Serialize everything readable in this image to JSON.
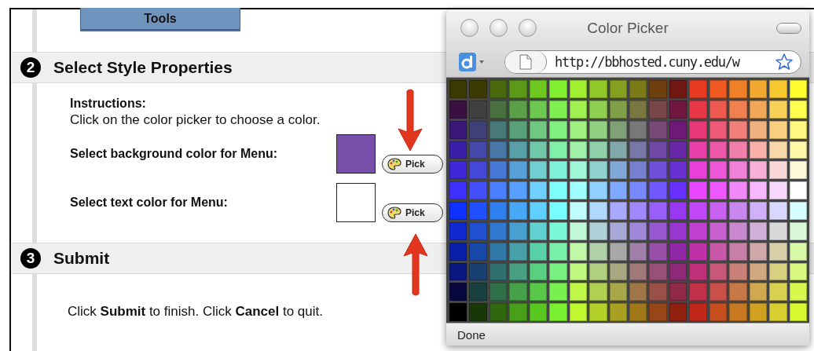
{
  "page": {
    "top_button": "Tools",
    "sections": [
      {
        "number": "2",
        "title": "Select Style Properties"
      },
      {
        "number": "3",
        "title": "Submit"
      }
    ],
    "instructions": {
      "heading": "Instructions:",
      "text": "Click on the color picker to choose a color."
    },
    "color_fields": [
      {
        "label": "Select background color for Menu:",
        "color": "#774ea8",
        "button": "Pick"
      },
      {
        "label": "Select text color for Menu:",
        "color": "#ffffff",
        "button": "Pick"
      }
    ],
    "submit_text": "Click **Submit** to finish. Click **Cancel** to quit."
  },
  "popup": {
    "window_title": "Color Picker",
    "url": "http://bbhosted.cuny.edu/w",
    "status": "Done",
    "swatch_rows": [
      {
        "swatches": [
          {
            "color": "#3a3a00"
          },
          {
            "color": "#3d3a00"
          },
          {
            "color": "#4a6a10"
          },
          {
            "color": "#5a9a18"
          },
          {
            "color": "#6ec820"
          },
          {
            "color": "#80f030"
          },
          {
            "color": "#a0f030"
          },
          {
            "color": "#90c828"
          },
          {
            "color": "#85a020"
          },
          {
            "color": "#7a7a18"
          },
          {
            "color": "#703f10"
          },
          {
            "color": "#701810"
          },
          {
            "color": "#e83a20"
          },
          {
            "color": "#f05a20"
          },
          {
            "color": "#f08028"
          },
          {
            "color": "#f0a830"
          },
          {
            "color": "#f8c830"
          },
          {
            "color": "#ffff30"
          }
        ]
      },
      {
        "swatches": [
          {
            "color": "#3a1040"
          },
          {
            "color": "#404040"
          },
          {
            "color": "#4a7040"
          },
          {
            "color": "#5aa048"
          },
          {
            "color": "#6cc850"
          },
          {
            "color": "#80f050"
          },
          {
            "color": "#a0f050"
          },
          {
            "color": "#90d050"
          },
          {
            "color": "#80a048"
          },
          {
            "color": "#787840"
          },
          {
            "color": "#784848"
          },
          {
            "color": "#701840"
          },
          {
            "color": "#e83848"
          },
          {
            "color": "#ee5a50"
          },
          {
            "color": "#f08050"
          },
          {
            "color": "#f0a858"
          },
          {
            "color": "#f8d058"
          },
          {
            "color": "#ffff50"
          }
        ]
      },
      {
        "swatches": [
          {
            "color": "#3a1878"
          },
          {
            "color": "#404078"
          },
          {
            "color": "#487878"
          },
          {
            "color": "#5aa078"
          },
          {
            "color": "#70c880"
          },
          {
            "color": "#80f080"
          },
          {
            "color": "#a0f080"
          },
          {
            "color": "#90d080"
          },
          {
            "color": "#80a078"
          },
          {
            "color": "#787878"
          },
          {
            "color": "#784878"
          },
          {
            "color": "#701878"
          },
          {
            "color": "#e83878"
          },
          {
            "color": "#ee5a78"
          },
          {
            "color": "#f08078"
          },
          {
            "color": "#f0b080"
          },
          {
            "color": "#f8d080"
          },
          {
            "color": "#fff880"
          }
        ]
      },
      {
        "swatches": [
          {
            "color": "#3a20a8"
          },
          {
            "color": "#4448a8"
          },
          {
            "color": "#4878a8"
          },
          {
            "color": "#58a0a8"
          },
          {
            "color": "#70c8a8"
          },
          {
            "color": "#80f0a8"
          },
          {
            "color": "#a0f0a8"
          },
          {
            "color": "#90d0a8"
          },
          {
            "color": "#80a8a8"
          },
          {
            "color": "#7878a8"
          },
          {
            "color": "#7048a8"
          },
          {
            "color": "#6828a8"
          },
          {
            "color": "#e840a8"
          },
          {
            "color": "#ee58a8"
          },
          {
            "color": "#f080a8"
          },
          {
            "color": "#f8b0a8"
          },
          {
            "color": "#f8d8a8"
          },
          {
            "color": "#fff8a8"
          }
        ]
      },
      {
        "swatches": [
          {
            "color": "#4028d8"
          },
          {
            "color": "#4448d8"
          },
          {
            "color": "#4878d8"
          },
          {
            "color": "#58a0d8"
          },
          {
            "color": "#70d0d0"
          },
          {
            "color": "#80f0d8"
          },
          {
            "color": "#a0f8d8"
          },
          {
            "color": "#90d0d0"
          },
          {
            "color": "#80a8d8"
          },
          {
            "color": "#7880d0"
          },
          {
            "color": "#7050d8"
          },
          {
            "color": "#6830d0"
          },
          {
            "color": "#e840d8"
          },
          {
            "color": "#ee58d8"
          },
          {
            "color": "#f080d8"
          },
          {
            "color": "#f8b0d8"
          },
          {
            "color": "#f8d8d8"
          },
          {
            "color": "#fff8d8"
          }
        ]
      },
      {
        "swatches": [
          {
            "color": "#4030ff"
          },
          {
            "color": "#4450ff"
          },
          {
            "color": "#4a80ff"
          },
          {
            "color": "#58a0ff"
          },
          {
            "color": "#70d0ff"
          },
          {
            "color": "#80ffff"
          },
          {
            "color": "#a0ffff"
          },
          {
            "color": "#90d0ff"
          },
          {
            "color": "#80a8ff"
          },
          {
            "color": "#7888ff"
          },
          {
            "color": "#7058ff"
          },
          {
            "color": "#6830ff"
          },
          {
            "color": "#e848ff"
          },
          {
            "color": "#f058ff"
          },
          {
            "color": "#f088f8"
          },
          {
            "color": "#f8b8ff"
          },
          {
            "color": "#f8d8ff"
          },
          {
            "color": "#ffffff"
          }
        ]
      },
      {
        "swatches": [
          {
            "color": "#1030ff"
          },
          {
            "color": "#2050ff"
          },
          {
            "color": "#3080f0"
          },
          {
            "color": "#48a8f8"
          },
          {
            "color": "#60d0ff"
          },
          {
            "color": "#78ffff"
          },
          {
            "color": "#c0ffff"
          },
          {
            "color": "#b0d8ff"
          },
          {
            "color": "#a8a8ff"
          },
          {
            "color": "#a088ff"
          },
          {
            "color": "#9860f8"
          },
          {
            "color": "#9838f0"
          },
          {
            "color": "#c048f8"
          },
          {
            "color": "#c860f0"
          },
          {
            "color": "#c888f0"
          },
          {
            "color": "#d0b0f8"
          },
          {
            "color": "#d8d8ff"
          },
          {
            "color": "#d8ffff"
          }
        ]
      },
      {
        "swatches": [
          {
            "color": "#1028d0"
          },
          {
            "color": "#2050d0"
          },
          {
            "color": "#3078d0"
          },
          {
            "color": "#48a0d0"
          },
          {
            "color": "#60d0d0"
          },
          {
            "color": "#78f8d8"
          },
          {
            "color": "#c0f8d8"
          },
          {
            "color": "#b0d0d8"
          },
          {
            "color": "#a8a8d8"
          },
          {
            "color": "#a088d8"
          },
          {
            "color": "#9858d0"
          },
          {
            "color": "#9838d0"
          },
          {
            "color": "#c040d0"
          },
          {
            "color": "#c860d0"
          },
          {
            "color": "#c888d0"
          },
          {
            "color": "#d0b0d8"
          },
          {
            "color": "#d8d8d8"
          },
          {
            "color": "#d8f8d8"
          }
        ]
      },
      {
        "swatches": [
          {
            "color": "#0820a8"
          },
          {
            "color": "#1848a8"
          },
          {
            "color": "#3078a8"
          },
          {
            "color": "#48a0a8"
          },
          {
            "color": "#58d0a8"
          },
          {
            "color": "#78f0a8"
          },
          {
            "color": "#c0f8a8"
          },
          {
            "color": "#b0d0a8"
          },
          {
            "color": "#a8a8a8"
          },
          {
            "color": "#a080a8"
          },
          {
            "color": "#9850a8"
          },
          {
            "color": "#9028a8"
          },
          {
            "color": "#c030a8"
          },
          {
            "color": "#c858a8"
          },
          {
            "color": "#c880a8"
          },
          {
            "color": "#d0a8a8"
          },
          {
            "color": "#d8d0a8"
          },
          {
            "color": "#d8f8a8"
          }
        ]
      },
      {
        "swatches": [
          {
            "color": "#081880"
          },
          {
            "color": "#184070"
          },
          {
            "color": "#307070"
          },
          {
            "color": "#48a080"
          },
          {
            "color": "#58d080"
          },
          {
            "color": "#78f080"
          },
          {
            "color": "#c0f880"
          },
          {
            "color": "#b0d080"
          },
          {
            "color": "#a8a880"
          },
          {
            "color": "#a07878"
          },
          {
            "color": "#985078"
          },
          {
            "color": "#902878"
          },
          {
            "color": "#c03078"
          },
          {
            "color": "#c85878"
          },
          {
            "color": "#c88078"
          },
          {
            "color": "#d0a880"
          },
          {
            "color": "#d8d080"
          },
          {
            "color": "#d8f880"
          }
        ]
      },
      {
        "swatches": [
          {
            "color": "#080840"
          },
          {
            "color": "#184040"
          },
          {
            "color": "#307048"
          },
          {
            "color": "#48a048"
          },
          {
            "color": "#58c848"
          },
          {
            "color": "#78f050"
          },
          {
            "color": "#c0f848"
          },
          {
            "color": "#b0d050"
          },
          {
            "color": "#a8a848"
          },
          {
            "color": "#a07848"
          },
          {
            "color": "#985048"
          },
          {
            "color": "#902848"
          },
          {
            "color": "#c03048"
          },
          {
            "color": "#c85048"
          },
          {
            "color": "#c87848"
          },
          {
            "color": "#d0a850"
          },
          {
            "color": "#d8d050"
          },
          {
            "color": "#d8f850"
          }
        ]
      },
      {
        "swatches": [
          {
            "color": "#000000"
          },
          {
            "color": "#183808"
          },
          {
            "color": "#306810"
          },
          {
            "color": "#48a018"
          },
          {
            "color": "#58c820"
          },
          {
            "color": "#78f030"
          },
          {
            "color": "#c0f830"
          },
          {
            "color": "#b0d028"
          },
          {
            "color": "#a8a020"
          },
          {
            "color": "#a07818"
          },
          {
            "color": "#984818"
          },
          {
            "color": "#902010"
          },
          {
            "color": "#c02818"
          },
          {
            "color": "#c85020"
          },
          {
            "color": "#c87820"
          },
          {
            "color": "#d0a020"
          },
          {
            "color": "#d8d030"
          },
          {
            "color": "#d8f830"
          }
        ]
      }
    ]
  }
}
